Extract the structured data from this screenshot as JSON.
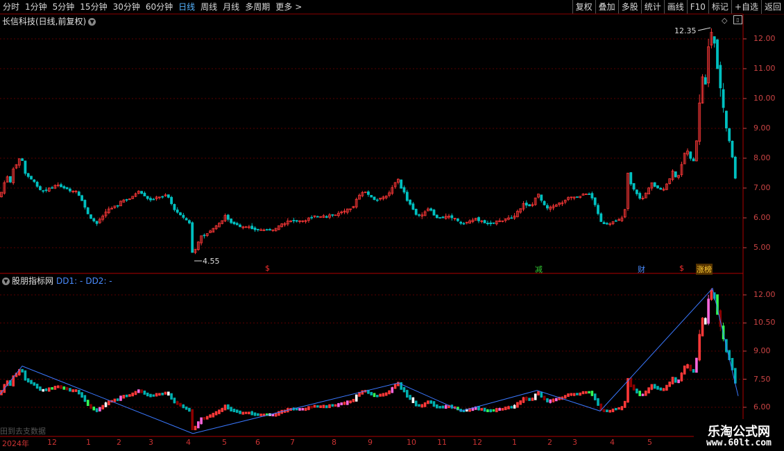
{
  "toolbar": {
    "periods": [
      "分时",
      "1分钟",
      "5分钟",
      "15分钟",
      "30分钟",
      "60分钟",
      "日线",
      "周线",
      "月线",
      "多周期",
      "更多"
    ],
    "active": "日线",
    "more_arrow": ">",
    "tools": [
      "复权",
      "叠加",
      "多股",
      "统计",
      "画线",
      "F10",
      "标记",
      "+自选",
      "返回"
    ]
  },
  "stock_title": "长信科技(日线,前复权)",
  "indicator": {
    "name": "股朋指标网",
    "dd1": "DD1: -",
    "dd2": "DD2: -"
  },
  "annotations": {
    "high": "12.35",
    "low": "4.55"
  },
  "events": [
    {
      "label": "$",
      "color": "#ff3030"
    },
    {
      "label": "减",
      "color": "#33cc33"
    },
    {
      "label": "财",
      "color": "#4a8cff"
    },
    {
      "label": "$",
      "color": "#ff3030"
    },
    {
      "label": "涨榜",
      "color": "#ffcc33"
    }
  ],
  "y_axis_main": [
    "12.00",
    "11.00",
    "10.00",
    "9.00",
    "8.00",
    "7.00",
    "6.00",
    "5.00"
  ],
  "y_axis_ind": [
    "12.00",
    "10.50",
    "9.00",
    "7.50",
    "6.00"
  ],
  "x_axis": [
    "2024年",
    "12",
    "1",
    "2",
    "3",
    "4",
    "5",
    "6",
    "7",
    "8",
    "9",
    "10",
    "11",
    "12",
    "1",
    "2",
    "3",
    "4",
    "5"
  ],
  "bottom_left_text": "田到去支数据",
  "watermark": {
    "name": "乐淘公式网",
    "url": "www.60lt.com"
  },
  "colors": {
    "up": "#ff3838",
    "down": "#00c0c0",
    "grid": "#5a0000",
    "zigzag": "#3a78ff",
    "axis": "#cc4444"
  },
  "chart_data": {
    "type": "candlestick",
    "title": "长信科技(日线,前复权)",
    "ylim": [
      4.3,
      12.7
    ],
    "yticks": [
      5,
      6,
      7,
      8,
      9,
      10,
      11,
      12
    ],
    "high": 12.35,
    "low": 4.55,
    "path": [
      [
        0,
        6.7
      ],
      [
        5,
        7.1
      ],
      [
        10,
        7.4
      ],
      [
        15,
        7.2
      ],
      [
        18,
        7.6
      ],
      [
        21,
        7.7
      ],
      [
        24,
        7.8
      ],
      [
        27,
        7.9
      ],
      [
        30,
        8.2
      ],
      [
        33,
        7.8
      ],
      [
        36,
        7.5
      ],
      [
        40,
        7.4
      ],
      [
        45,
        7.3
      ],
      [
        50,
        7.2
      ],
      [
        55,
        7.0
      ],
      [
        60,
        6.9
      ],
      [
        65,
        6.9
      ],
      [
        70,
        7.0
      ],
      [
        75,
        7.0
      ],
      [
        80,
        7.1
      ],
      [
        85,
        7.1
      ],
      [
        90,
        7.0
      ],
      [
        95,
        7.0
      ],
      [
        100,
        6.9
      ],
      [
        105,
        6.9
      ],
      [
        110,
        6.9
      ],
      [
        115,
        6.7
      ],
      [
        120,
        6.5
      ],
      [
        125,
        6.2
      ],
      [
        130,
        6.0
      ],
      [
        135,
        5.9
      ],
      [
        140,
        5.8
      ],
      [
        145,
        6.0
      ],
      [
        150,
        6.1
      ],
      [
        155,
        6.3
      ],
      [
        160,
        6.3
      ],
      [
        165,
        6.4
      ],
      [
        170,
        6.4
      ],
      [
        175,
        6.6
      ],
      [
        180,
        6.6
      ],
      [
        185,
        6.6
      ],
      [
        190,
        6.7
      ],
      [
        195,
        6.8
      ],
      [
        200,
        6.9
      ],
      [
        205,
        6.8
      ],
      [
        210,
        6.7
      ],
      [
        215,
        6.6
      ],
      [
        220,
        6.6
      ],
      [
        225,
        6.7
      ],
      [
        230,
        6.7
      ],
      [
        235,
        6.7
      ],
      [
        240,
        6.8
      ],
      [
        245,
        6.6
      ],
      [
        250,
        6.3
      ],
      [
        255,
        6.2
      ],
      [
        260,
        6.1
      ],
      [
        265,
        6.0
      ],
      [
        270,
        5.9
      ],
      [
        274,
        5.8
      ],
      [
        278,
        4.6
      ],
      [
        282,
        5.0
      ],
      [
        286,
        5.2
      ],
      [
        290,
        5.4
      ],
      [
        295,
        5.4
      ],
      [
        300,
        5.5
      ],
      [
        305,
        5.6
      ],
      [
        310,
        5.7
      ],
      [
        315,
        5.8
      ],
      [
        320,
        5.9
      ],
      [
        325,
        6.1
      ],
      [
        330,
        5.9
      ],
      [
        335,
        5.8
      ],
      [
        340,
        5.8
      ],
      [
        345,
        5.7
      ],
      [
        350,
        5.7
      ],
      [
        355,
        5.7
      ],
      [
        360,
        5.7
      ],
      [
        365,
        5.6
      ],
      [
        370,
        5.6
      ],
      [
        375,
        5.6
      ],
      [
        380,
        5.6
      ],
      [
        385,
        5.6
      ],
      [
        390,
        5.6
      ],
      [
        395,
        5.6
      ],
      [
        400,
        5.7
      ],
      [
        405,
        5.8
      ],
      [
        410,
        5.8
      ],
      [
        415,
        5.9
      ],
      [
        420,
        5.9
      ],
      [
        425,
        5.9
      ],
      [
        430,
        5.9
      ],
      [
        435,
        5.9
      ],
      [
        440,
        5.9
      ],
      [
        445,
        6.0
      ],
      [
        450,
        6.0
      ],
      [
        455,
        6.1
      ],
      [
        460,
        6.0
      ],
      [
        465,
        6.1
      ],
      [
        470,
        6.0
      ],
      [
        475,
        6.1
      ],
      [
        480,
        6.1
      ],
      [
        485,
        6.1
      ],
      [
        490,
        6.2
      ],
      [
        495,
        6.2
      ],
      [
        500,
        6.3
      ],
      [
        505,
        6.3
      ],
      [
        510,
        6.4
      ],
      [
        515,
        6.7
      ],
      [
        520,
        6.8
      ],
      [
        525,
        6.9
      ],
      [
        530,
        6.8
      ],
      [
        535,
        6.7
      ],
      [
        540,
        6.6
      ],
      [
        545,
        6.6
      ],
      [
        550,
        6.7
      ],
      [
        555,
        6.7
      ],
      [
        560,
        6.8
      ],
      [
        565,
        7.0
      ],
      [
        570,
        7.2
      ],
      [
        574,
        7.3
      ],
      [
        578,
        7.0
      ],
      [
        582,
        6.9
      ],
      [
        586,
        6.6
      ],
      [
        590,
        6.5
      ],
      [
        595,
        6.3
      ],
      [
        600,
        6.1
      ],
      [
        605,
        6.1
      ],
      [
        610,
        6.1
      ],
      [
        615,
        6.3
      ],
      [
        620,
        6.3
      ],
      [
        625,
        6.1
      ],
      [
        630,
        6.0
      ],
      [
        635,
        6.0
      ],
      [
        640,
        6.0
      ],
      [
        645,
        6.1
      ],
      [
        650,
        6.0
      ],
      [
        655,
        6.0
      ],
      [
        660,
        5.9
      ],
      [
        665,
        5.8
      ],
      [
        670,
        5.8
      ],
      [
        675,
        5.9
      ],
      [
        680,
        5.9
      ],
      [
        685,
        6.0
      ],
      [
        690,
        5.9
      ],
      [
        695,
        5.9
      ],
      [
        700,
        5.8
      ],
      [
        705,
        5.8
      ],
      [
        710,
        5.8
      ],
      [
        715,
        5.9
      ],
      [
        720,
        5.9
      ],
      [
        725,
        5.9
      ],
      [
        730,
        6.0
      ],
      [
        735,
        6.0
      ],
      [
        740,
        6.0
      ],
      [
        745,
        6.2
      ],
      [
        750,
        6.3
      ],
      [
        755,
        6.5
      ],
      [
        760,
        6.4
      ],
      [
        765,
        6.4
      ],
      [
        770,
        6.5
      ],
      [
        774,
        6.9
      ],
      [
        778,
        6.7
      ],
      [
        782,
        6.5
      ],
      [
        786,
        6.4
      ],
      [
        790,
        6.3
      ],
      [
        795,
        6.4
      ],
      [
        800,
        6.4
      ],
      [
        805,
        6.5
      ],
      [
        810,
        6.5
      ],
      [
        815,
        6.6
      ],
      [
        820,
        6.7
      ],
      [
        825,
        6.7
      ],
      [
        830,
        6.7
      ],
      [
        835,
        6.7
      ],
      [
        840,
        6.8
      ],
      [
        845,
        6.8
      ],
      [
        850,
        6.8
      ],
      [
        855,
        6.6
      ],
      [
        860,
        6.3
      ],
      [
        865,
        5.9
      ],
      [
        870,
        5.8
      ],
      [
        875,
        5.8
      ],
      [
        880,
        5.8
      ],
      [
        885,
        5.9
      ],
      [
        890,
        5.9
      ],
      [
        895,
        6.0
      ],
      [
        900,
        6.0
      ],
      [
        904,
        7.6
      ],
      [
        908,
        7.2
      ],
      [
        912,
        7.0
      ],
      [
        916,
        6.9
      ],
      [
        920,
        6.7
      ],
      [
        925,
        6.6
      ],
      [
        930,
        6.8
      ],
      [
        935,
        7.0
      ],
      [
        940,
        7.2
      ],
      [
        945,
        7.0
      ],
      [
        950,
        7.0
      ],
      [
        955,
        6.9
      ],
      [
        960,
        7.1
      ],
      [
        965,
        7.3
      ],
      [
        970,
        7.6
      ],
      [
        975,
        7.3
      ],
      [
        980,
        7.5
      ],
      [
        985,
        8.1
      ],
      [
        990,
        8.3
      ],
      [
        995,
        8.0
      ],
      [
        1000,
        7.9
      ],
      [
        1004,
        8.6
      ],
      [
        1008,
        9.8
      ],
      [
        1012,
        10.8
      ],
      [
        1016,
        10.2
      ],
      [
        1020,
        11.6
      ],
      [
        1024,
        12.1
      ],
      [
        1027,
        12.35
      ],
      [
        1030,
        11.8
      ],
      [
        1034,
        11.0
      ],
      [
        1038,
        10.4
      ],
      [
        1042,
        9.8
      ],
      [
        1046,
        9.1
      ],
      [
        1050,
        8.7
      ],
      [
        1054,
        8.3
      ],
      [
        1058,
        7.6
      ],
      [
        1062,
        7.0
      ],
      [
        1064,
        6.6
      ]
    ],
    "zigzag": [
      [
        0,
        6.7
      ],
      [
        32,
        8.2
      ],
      [
        278,
        4.6
      ],
      [
        574,
        7.3
      ],
      [
        665,
        5.8
      ],
      [
        774,
        6.9
      ],
      [
        865,
        5.8
      ],
      [
        1027,
        12.35
      ],
      [
        1064,
        6.6
      ]
    ]
  }
}
